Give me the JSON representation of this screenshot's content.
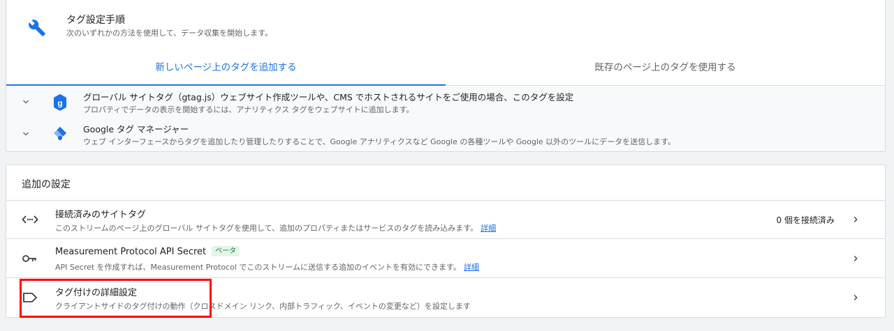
{
  "setup": {
    "title": "タグ設定手順",
    "subtitle": "次のいずれかの方法を使用して、データ収集を開始します。",
    "icon": "wrench-icon"
  },
  "tabs": [
    {
      "label": "新しいページ上のタグを追加する",
      "active": true
    },
    {
      "label": "既存のページ上のタグを使用する",
      "active": false
    }
  ],
  "tag_options": [
    {
      "title": "グローバル サイトタグ（gtag.js）ウェブサイト作成ツールや、CMS でホストされるサイトをご使用の場合、このタグを設定",
      "subtitle": "プロパティでデータの表示を開始するには、アナリティクス タグをウェブサイトに追加します。",
      "icon": "gtag-icon",
      "icon_letter": "g"
    },
    {
      "title": "Google タグ マネージャー",
      "subtitle": "ウェブ インターフェースからタグを追加したり管理したりすることで、Google アナリティクスなど Google の各種ツールや Google 以外のツールにデータを送信します。",
      "icon": "tag-manager-icon"
    }
  ],
  "additional": {
    "title": "追加の設定",
    "rows": [
      {
        "title": "接続済みのサイトタグ",
        "subtitle": "このストリームのページ上のグローバル サイトタグを使用して、追加のプロパティまたはサービスのタグを読み込みます。",
        "link": "詳細",
        "status": "0 個を接続済み",
        "icon": "code-icon"
      },
      {
        "title": "Measurement Protocol API Secret",
        "badge": "ベータ",
        "subtitle": "API Secret を作成すれば、Measurement Protocol でこのストリームに送信する追加のイベントを有効にできます。",
        "link": "詳細",
        "icon": "key-icon"
      },
      {
        "title": "タグ付けの詳細設定",
        "subtitle": "クライアントサイドのタグ付けの動作（クロスドメイン リンク、内部トラフィック、イベントの変更など）を設定します",
        "icon": "label-icon"
      }
    ]
  },
  "colors": {
    "accent": "#1a73e8",
    "highlight": "#ff0000",
    "badge_bg": "#e6f4ea",
    "badge_fg": "#188038"
  }
}
